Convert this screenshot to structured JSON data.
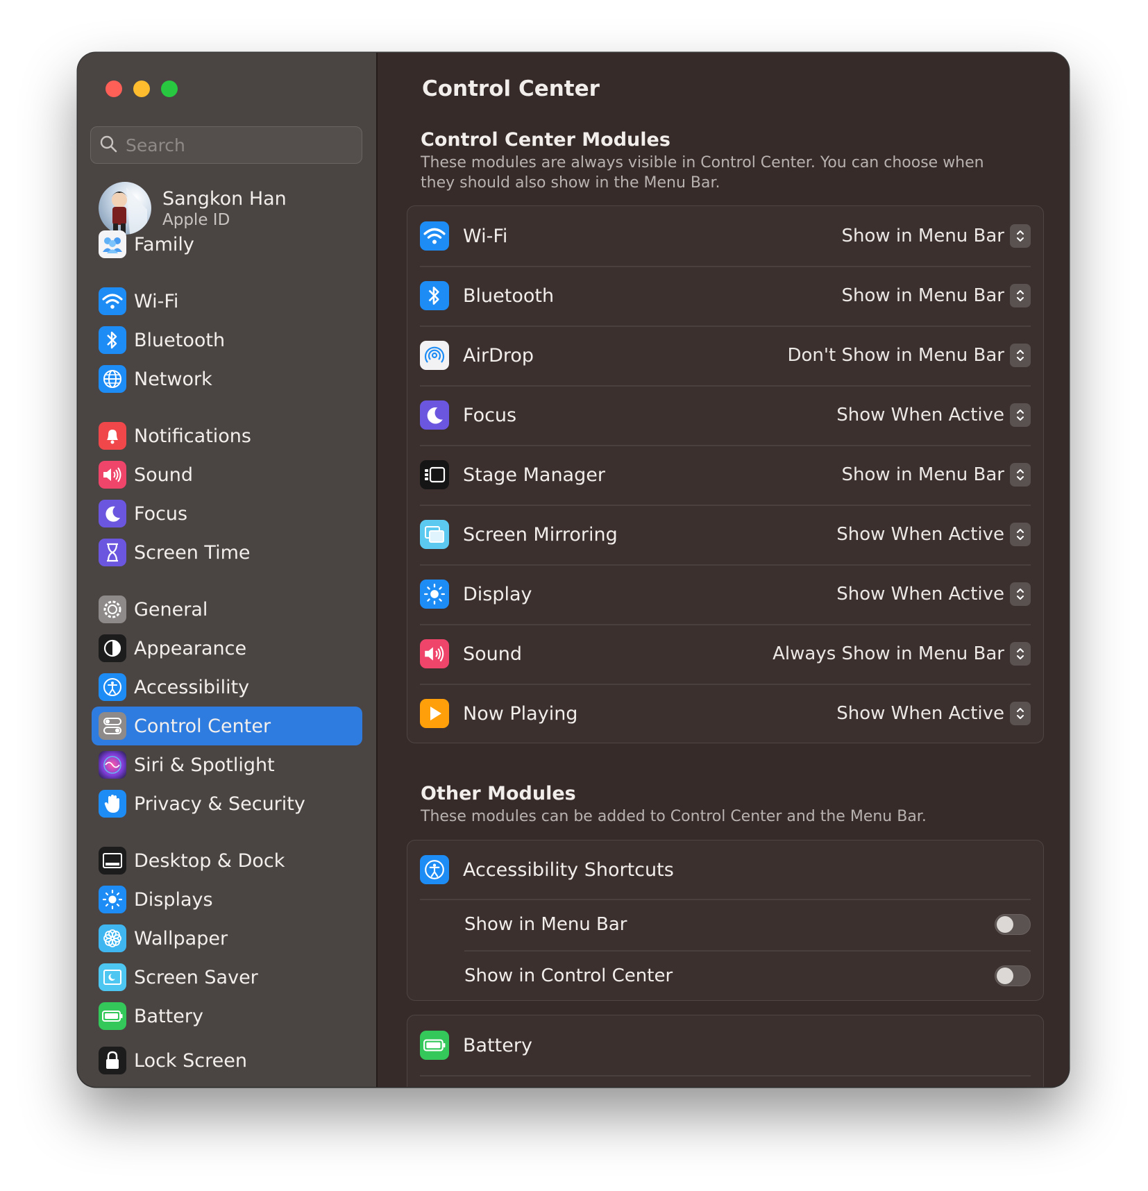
{
  "search": {
    "placeholder": "Search"
  },
  "profile": {
    "name": "Sangkon Han",
    "subtitle": "Apple ID"
  },
  "sidebar": {
    "items": [
      {
        "label": "Family"
      },
      {
        "label": "Wi-Fi"
      },
      {
        "label": "Bluetooth"
      },
      {
        "label": "Network"
      },
      {
        "label": "Notifications"
      },
      {
        "label": "Sound"
      },
      {
        "label": "Focus"
      },
      {
        "label": "Screen Time"
      },
      {
        "label": "General"
      },
      {
        "label": "Appearance"
      },
      {
        "label": "Accessibility"
      },
      {
        "label": "Control Center"
      },
      {
        "label": "Siri & Spotlight"
      },
      {
        "label": "Privacy & Security"
      },
      {
        "label": "Desktop & Dock"
      },
      {
        "label": "Displays"
      },
      {
        "label": "Wallpaper"
      },
      {
        "label": "Screen Saver"
      },
      {
        "label": "Battery"
      },
      {
        "label": "Lock Screen"
      }
    ],
    "active": "Control Center"
  },
  "main": {
    "title": "Control Center",
    "modules_section": {
      "heading": "Control Center Modules",
      "description": "These modules are always visible in Control Center. You can choose when they should also show in the Menu Bar."
    },
    "modules": [
      {
        "label": "Wi-Fi",
        "value": "Show in Menu Bar"
      },
      {
        "label": "Bluetooth",
        "value": "Show in Menu Bar"
      },
      {
        "label": "AirDrop",
        "value": "Don't Show in Menu Bar"
      },
      {
        "label": "Focus",
        "value": "Show When Active"
      },
      {
        "label": "Stage Manager",
        "value": "Show in Menu Bar"
      },
      {
        "label": "Screen Mirroring",
        "value": "Show When Active"
      },
      {
        "label": "Display",
        "value": "Show When Active"
      },
      {
        "label": "Sound",
        "value": "Always Show in Menu Bar"
      },
      {
        "label": "Now Playing",
        "value": "Show When Active"
      }
    ],
    "other_section": {
      "heading": "Other Modules",
      "description": "These modules can be added to Control Center and the Menu Bar."
    },
    "accessibility_shortcuts": {
      "label": "Accessibility Shortcuts",
      "show_in_menu_bar": {
        "label": "Show in Menu Bar",
        "on": false
      },
      "show_in_control_center": {
        "label": "Show in Control Center",
        "on": false
      }
    },
    "battery": {
      "label": "Battery"
    }
  },
  "colors": {
    "accent": "#2f7ce0",
    "sidebar_bg": "#4a4442",
    "content_bg": "#362b29",
    "close": "#fe5f57",
    "minimize": "#febc2e",
    "zoom": "#28c840"
  }
}
